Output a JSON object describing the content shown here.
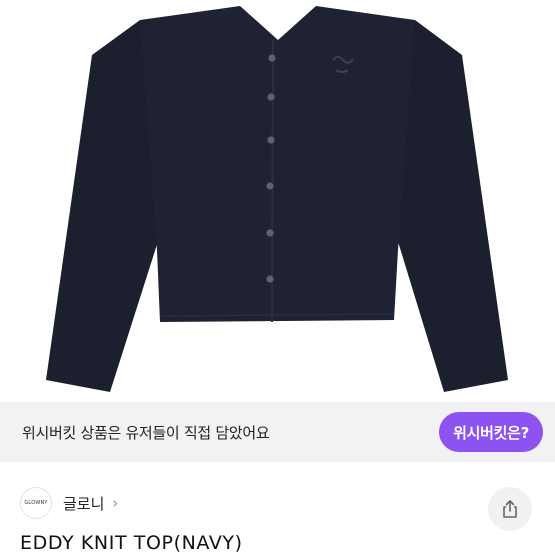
{
  "banner": {
    "text": "위시버킷 상품은 유저들이 직접 담았어요",
    "button_label": "위시버킷은?"
  },
  "shop": {
    "logo_text": "GLOWNY",
    "name": "글로니",
    "chevron": "›"
  },
  "product": {
    "title": "EDDY KNIT TOP(NAVY)",
    "image_icon": "navy-cardigan-image"
  },
  "icons": {
    "share": "share-icon"
  },
  "colors": {
    "accent": "#8d52f2",
    "garment": "#1c2030",
    "banner_bg": "#f2f2f4"
  }
}
